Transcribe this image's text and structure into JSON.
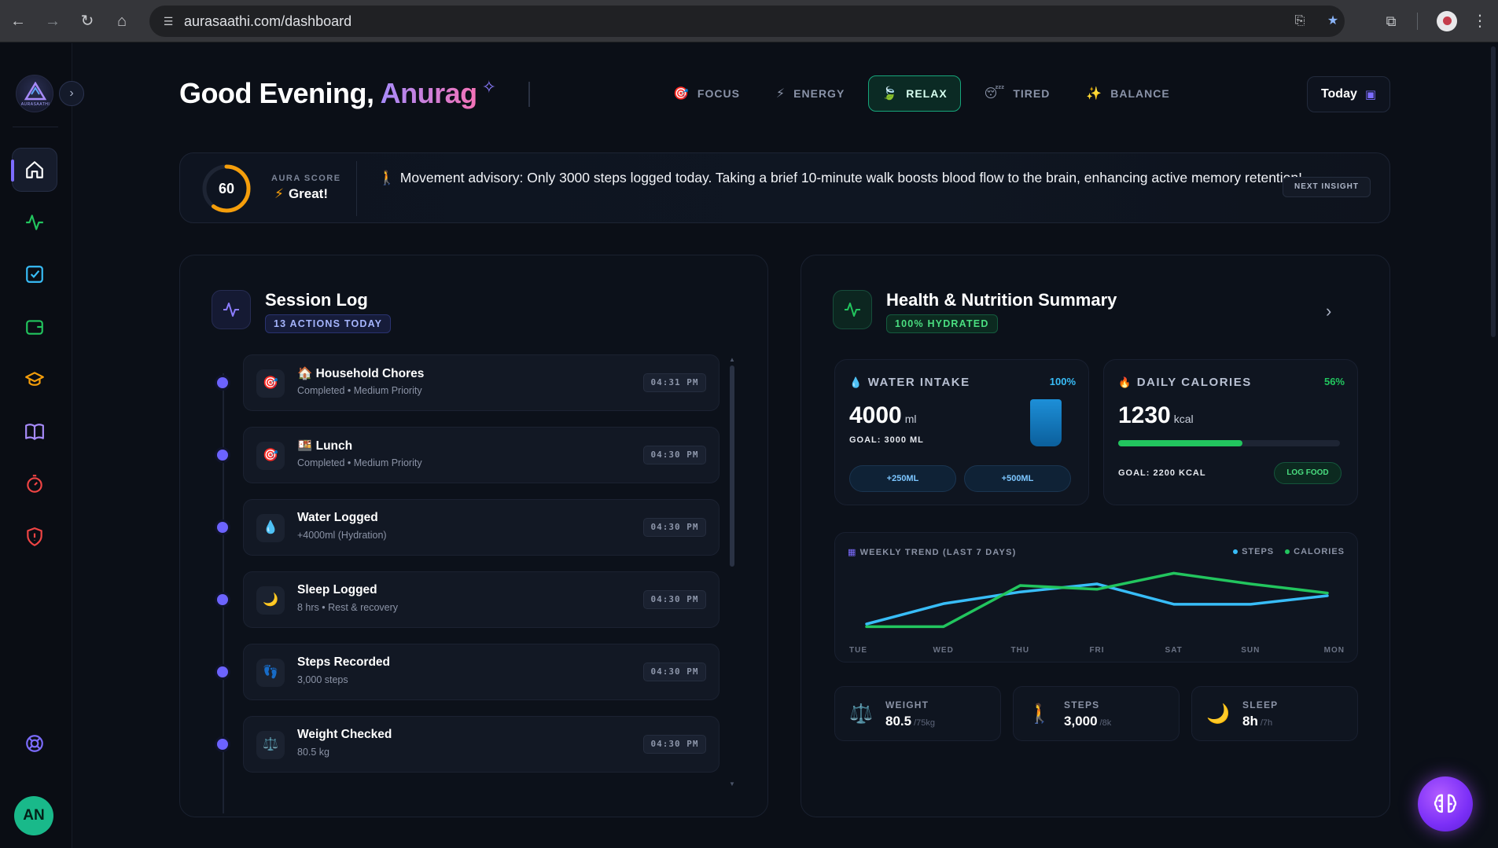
{
  "browser": {
    "url": "aurasaathi.com/dashboard"
  },
  "sidebar": {
    "logo_text": "AURASAATHI",
    "avatar_initials": "AN"
  },
  "header": {
    "greeting": "Good Evening, ",
    "name": "Anurag",
    "modes": [
      {
        "label": "FOCUS",
        "icon": "🎯"
      },
      {
        "label": "ENERGY",
        "icon": "⚡"
      },
      {
        "label": "RELAX",
        "icon": "🍃"
      },
      {
        "label": "TIRED",
        "icon": "😴"
      },
      {
        "label": "BALANCE",
        "icon": "✨"
      }
    ],
    "active_mode": "RELAX",
    "today_label": "Today"
  },
  "insight": {
    "score": "60",
    "score_fraction": 0.6,
    "score_label": "AURA SCORE",
    "score_value": "Great!",
    "text": "Movement advisory: Only 3000 steps logged today. Taking a brief 10-minute walk boosts blood flow to the brain, enhancing active memory retention!",
    "next_label": "NEXT INSIGHT"
  },
  "session_log": {
    "title": "Session Log",
    "badge": "13 ACTIONS TODAY",
    "items": [
      {
        "icon": "🎯",
        "title": "🏠 Household Chores",
        "sub": "Completed • Medium Priority",
        "time": "04:31 PM"
      },
      {
        "icon": "🎯",
        "title": "🍱 Lunch",
        "sub": "Completed • Medium Priority",
        "time": "04:30 PM"
      },
      {
        "icon": "💧",
        "title": "Water Logged",
        "sub": "+4000ml (Hydration)",
        "time": "04:30 PM"
      },
      {
        "icon": "🌙",
        "title": "Sleep Logged",
        "sub": "8 hrs • Rest & recovery",
        "time": "04:30 PM"
      },
      {
        "icon": "👣",
        "title": "Steps Recorded",
        "sub": "3,000 steps",
        "time": "04:30 PM"
      },
      {
        "icon": "⚖️",
        "title": "Weight Checked",
        "sub": "80.5 kg",
        "time": "04:30 PM"
      }
    ]
  },
  "health": {
    "title": "Health & Nutrition Summary",
    "badge": "100% HYDRATED",
    "water": {
      "label": "WATER INTAKE",
      "pct": "100%",
      "value": "4000",
      "unit": "ml",
      "goal": "GOAL: 3000 ML",
      "fill_fraction": 1.0,
      "btn1": "+250ML",
      "btn2": "+500ML"
    },
    "calories": {
      "label": "DAILY CALORIES",
      "pct": "56%",
      "value": "1230",
      "unit": "kcal",
      "goal": "GOAL: 2200 KCAL",
      "fill_fraction": 0.56,
      "log_label": "LOG FOOD"
    },
    "stats": [
      {
        "label": "WEIGHT",
        "value": "80.5",
        "goal": "/75kg",
        "icon": "⚖️"
      },
      {
        "label": "STEPS",
        "value": "3,000",
        "goal": "/8k",
        "icon": "🚶"
      },
      {
        "label": "SLEEP",
        "value": "8h",
        "goal": "/7h",
        "icon": "🌙"
      }
    ]
  },
  "colors": {
    "accent": "#7c6cff",
    "steps": "#38bdf8",
    "calories": "#22c55e"
  },
  "chart_data": {
    "type": "line",
    "title": "WEEKLY TREND (LAST 7 DAYS)",
    "categories": [
      "TUE",
      "WED",
      "THU",
      "FRI",
      "SAT",
      "SUN",
      "MON"
    ],
    "ylim": [
      0,
      1
    ],
    "series": [
      {
        "name": "STEPS",
        "color": "#38bdf8",
        "values": [
          0.0,
          0.38,
          0.6,
          0.75,
          0.37,
          0.37,
          0.53
        ]
      },
      {
        "name": "CALORIES",
        "color": "#22c55e",
        "values": [
          -0.05,
          -0.05,
          0.72,
          0.65,
          0.95,
          0.75,
          0.58
        ]
      }
    ],
    "legend": "top-right",
    "grid": false
  }
}
